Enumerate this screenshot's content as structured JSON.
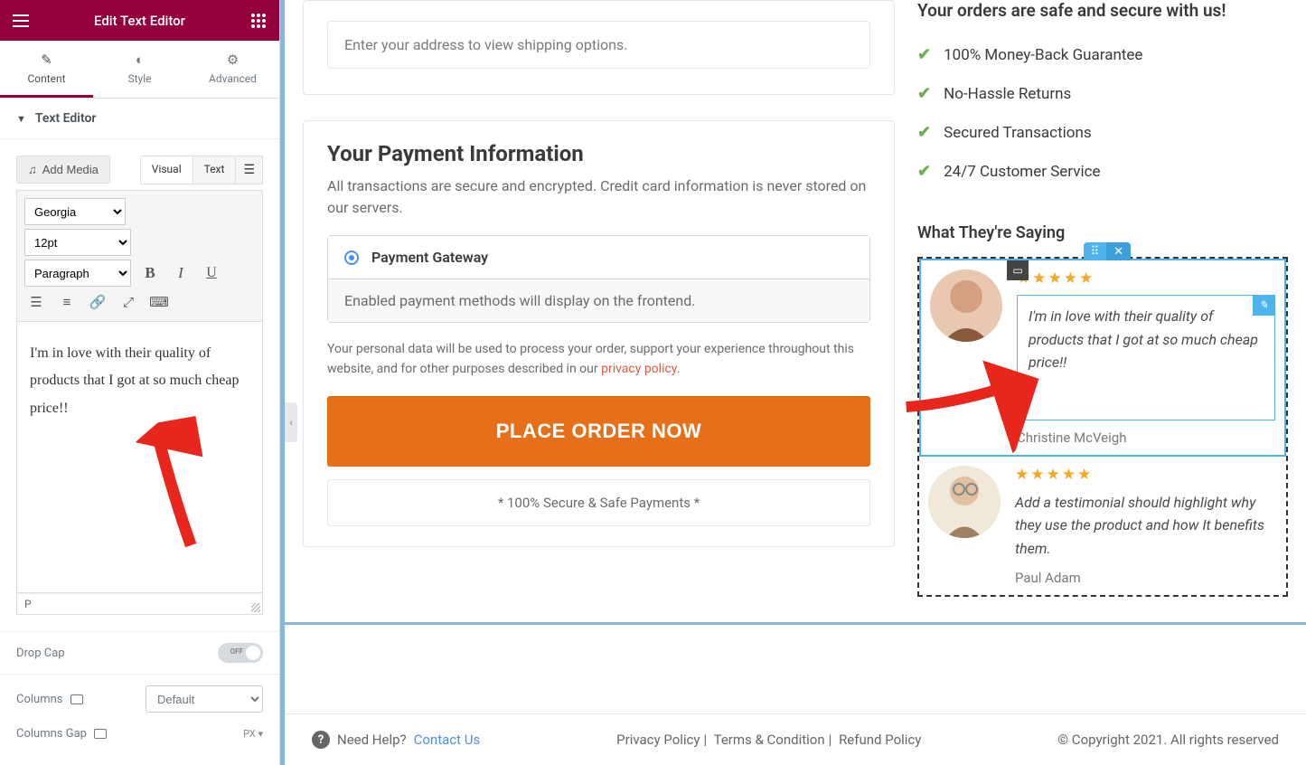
{
  "sidebar": {
    "title": "Edit Text Editor",
    "tabs": [
      {
        "label": "Content",
        "icon": "✎"
      },
      {
        "label": "Style",
        "icon": "◐"
      },
      {
        "label": "Advanced",
        "icon": "⚙"
      }
    ],
    "section_title": "Text Editor",
    "add_media": "Add Media",
    "mode_visual": "Visual",
    "mode_text": "Text",
    "font": "Georgia",
    "size": "12pt",
    "format": "Paragraph",
    "content": "I'm in love with their quality of products that I got at so much cheap price!!",
    "footer_path": "P",
    "dropcap_label": "Drop Cap",
    "dropcap_toggle": "OFF",
    "columns_label": "Columns",
    "columns_value": "Default",
    "columns_gap_label": "Columns Gap",
    "columns_gap_unit": "PX"
  },
  "preview": {
    "address_placeholder": "Enter your address to view shipping options.",
    "payment_title": "Your Payment Information",
    "payment_subtitle": "All transactions are secure and encrypted. Credit card information is never stored on our servers.",
    "payment_option": "Payment Gateway",
    "payment_info": "Enabled payment methods will display on the frontend.",
    "disclaimer_pre": "Your personal data will be used to process your order, support your experience throughout this website, and for other purposes described in our ",
    "disclaimer_link": "privacy policy",
    "order_btn": "PLACE ORDER NOW",
    "secure_note": "* 100% Secure & Safe Payments *",
    "side_heading": "Your orders are safe and secure with us!",
    "trust_items": [
      "100% Money-Back Guarantee",
      "No-Hassle Returns",
      "Secured Transactions",
      "24/7 Customer Service"
    ],
    "saying_heading": "What They're Saying",
    "testimonials": [
      {
        "quote": "I'm in love with their quality of products that I got at so much cheap price!!",
        "author": "Christine McVeigh"
      },
      {
        "quote": "Add a testimonial should highlight why they use the product and how It benefits them.",
        "author": "Paul Adam"
      }
    ]
  },
  "footer": {
    "need_help": "Need Help?",
    "contact": "Contact Us",
    "links": [
      "Privacy Policy",
      "Terms & Condition",
      "Refund Policy"
    ],
    "copyright": "© Copyright 2021. All rights reserved"
  }
}
